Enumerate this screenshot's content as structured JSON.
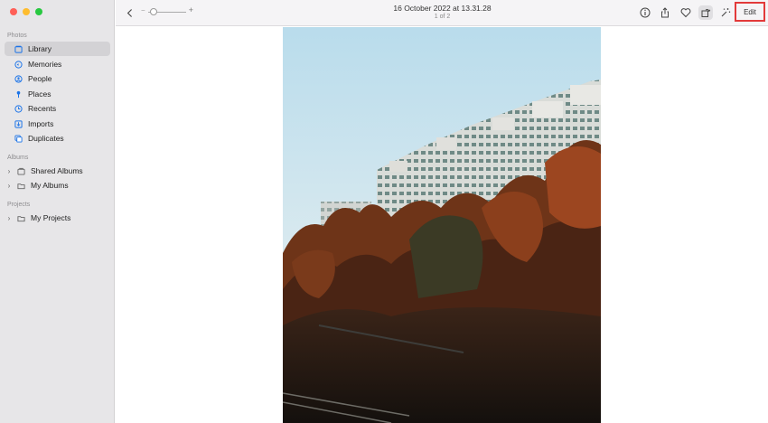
{
  "sidebar": {
    "sections": [
      {
        "title": "Photos",
        "items": [
          {
            "label": "Library",
            "icon": "library-icon",
            "active": true
          },
          {
            "label": "Memories",
            "icon": "memories-icon"
          },
          {
            "label": "People",
            "icon": "people-icon"
          },
          {
            "label": "Places",
            "icon": "places-icon"
          },
          {
            "label": "Recents",
            "icon": "recents-icon"
          },
          {
            "label": "Imports",
            "icon": "imports-icon"
          },
          {
            "label": "Duplicates",
            "icon": "duplicates-icon"
          }
        ]
      },
      {
        "title": "Albums",
        "items": [
          {
            "label": "Shared Albums",
            "icon": "shared-albums-icon"
          },
          {
            "label": "My Albums",
            "icon": "folder-icon"
          }
        ]
      },
      {
        "title": "Projects",
        "items": [
          {
            "label": "My Projects",
            "icon": "folder-icon"
          }
        ]
      }
    ]
  },
  "toolbar": {
    "title": "16 October 2022 at 13.31.28",
    "subtitle": "1 of 2",
    "zoom_minus": "−",
    "zoom_plus": "+",
    "edit_label": "Edit"
  },
  "colors": {
    "accent": "#1a73e8",
    "highlight_border": "#e23a3a",
    "traffic_red": "#ff5f57",
    "traffic_yellow": "#febc2e",
    "traffic_green": "#28c840"
  }
}
